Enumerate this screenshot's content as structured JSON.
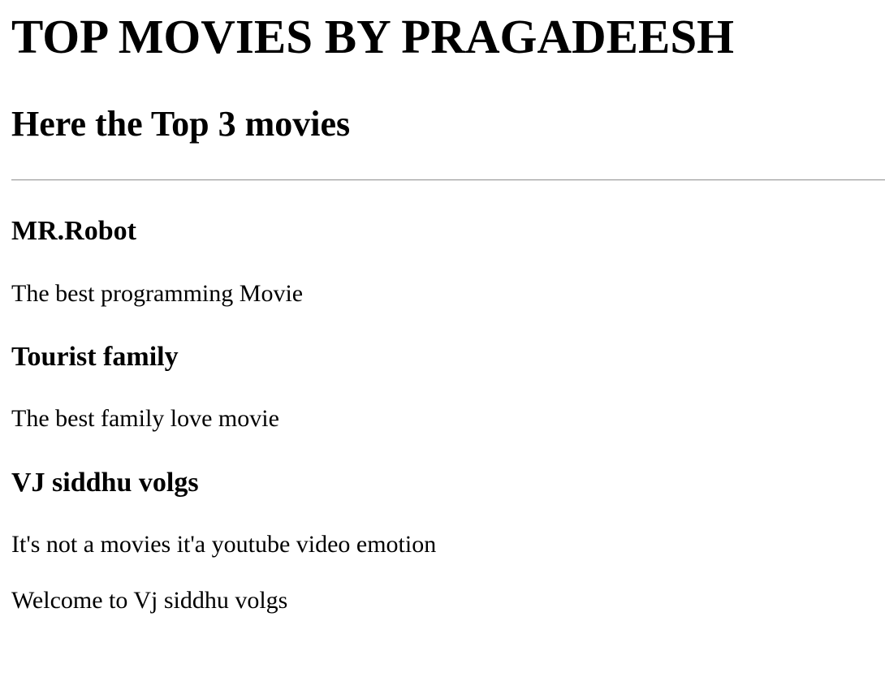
{
  "header": {
    "title": "TOP MOVIES BY PRAGADEESH",
    "subtitle": "Here the Top 3 movies"
  },
  "movies": [
    {
      "title": "MR.Robot",
      "description": "The best programming Movie"
    },
    {
      "title": "Tourist family",
      "description": "The best family love movie"
    },
    {
      "title": "VJ siddhu volgs",
      "description": "It's not a movies it'a youtube video emotion"
    }
  ],
  "footer": {
    "welcome": "Welcome to Vj siddhu volgs"
  }
}
